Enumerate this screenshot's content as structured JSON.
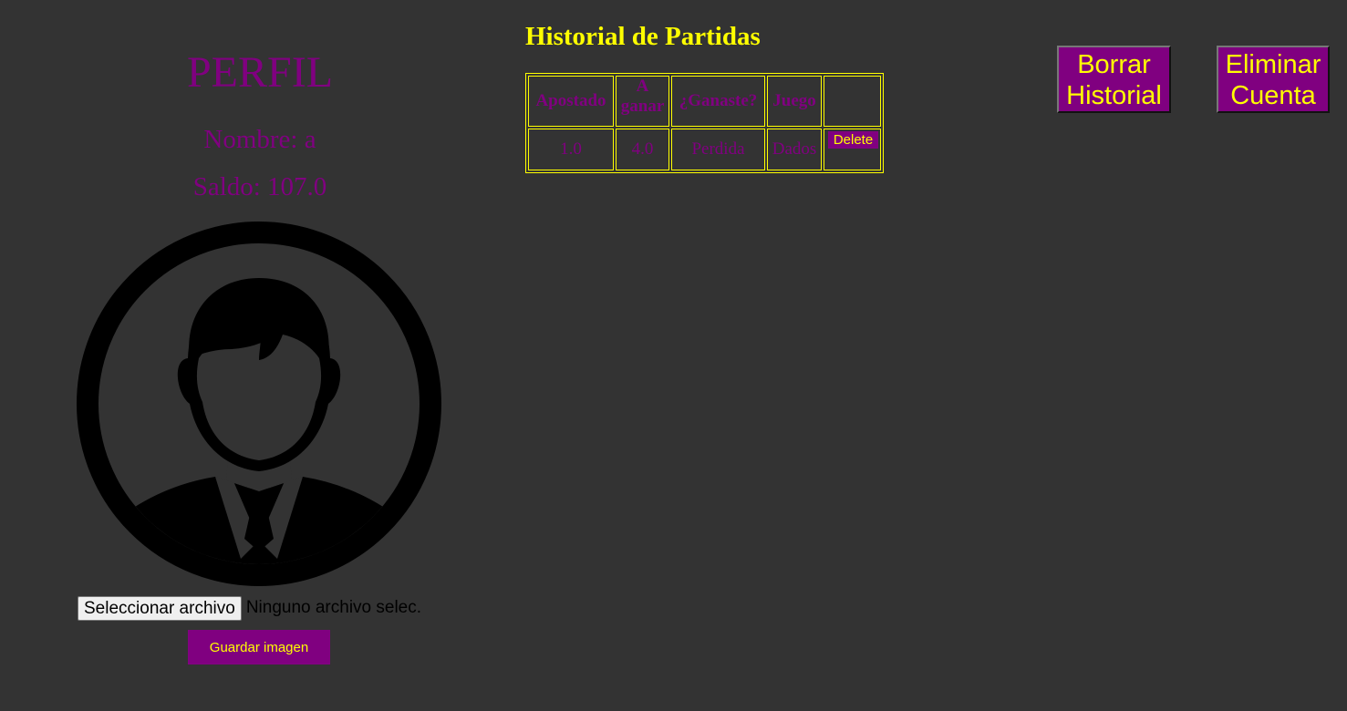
{
  "profile": {
    "title": "PERFIL",
    "name": "Nombre: a",
    "balance": "Saldo: 107.0"
  },
  "avatar": {
    "icon": "user-avatar-icon"
  },
  "upload": {
    "choose_file_label": "Seleccionar archivo",
    "no_file_text": "Ninguno archivo selec.",
    "save_label": "Guardar imagen"
  },
  "history": {
    "title": "Historial de Partidas",
    "columns": [
      "Apostado",
      "A ganar",
      "¿Ganaste?",
      "Juego",
      ""
    ],
    "rows": [
      {
        "bet": "1.0",
        "to_win": "4.0",
        "won": "Perdida",
        "game": "Dados",
        "action": "Delete"
      }
    ]
  },
  "actions": {
    "clear_history": "Borrar Historial",
    "delete_account": "Eliminar Cuenta"
  },
  "colors": {
    "background": "#333333",
    "accent": "#800080",
    "highlight": "#ffff00"
  }
}
